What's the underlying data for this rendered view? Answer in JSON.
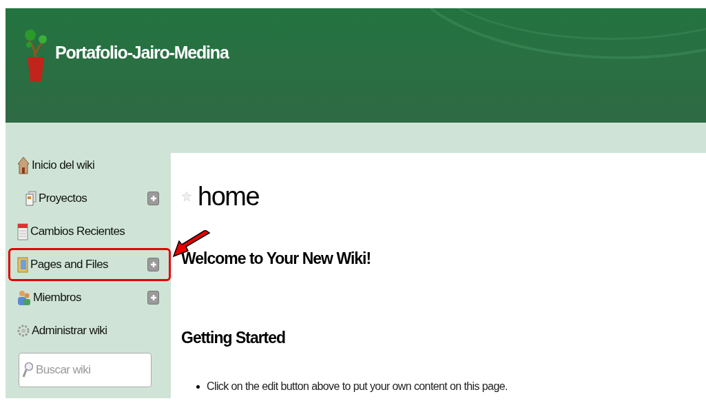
{
  "header": {
    "title": "Portafolio-Jairo-Medina"
  },
  "sidebar": {
    "items": [
      {
        "label": "Inicio del wiki",
        "kind": "home",
        "add": false,
        "highlighted": false,
        "children": [
          {
            "label": "Proyectos",
            "kind": "page",
            "add": true,
            "highlighted": false
          }
        ]
      },
      {
        "label": "Cambios Recientes",
        "kind": "calendar",
        "add": false,
        "highlighted": false
      },
      {
        "label": "Pages and Files",
        "kind": "folder",
        "add": true,
        "highlighted": true
      },
      {
        "label": "Miembros",
        "kind": "people",
        "add": true,
        "highlighted": false
      },
      {
        "label": "Administrar wiki",
        "kind": "gear",
        "add": false,
        "highlighted": false
      }
    ],
    "search": {
      "placeholder": "Buscar wiki"
    }
  },
  "page": {
    "title": "home",
    "starred": false,
    "content": [
      {
        "kind": "heading",
        "text": "Welcome to Your New Wiki!"
      },
      {
        "kind": "heading",
        "text": "Getting Started"
      },
      {
        "kind": "bullet",
        "text": "Click on the edit button above to put your own content on this page."
      }
    ]
  }
}
